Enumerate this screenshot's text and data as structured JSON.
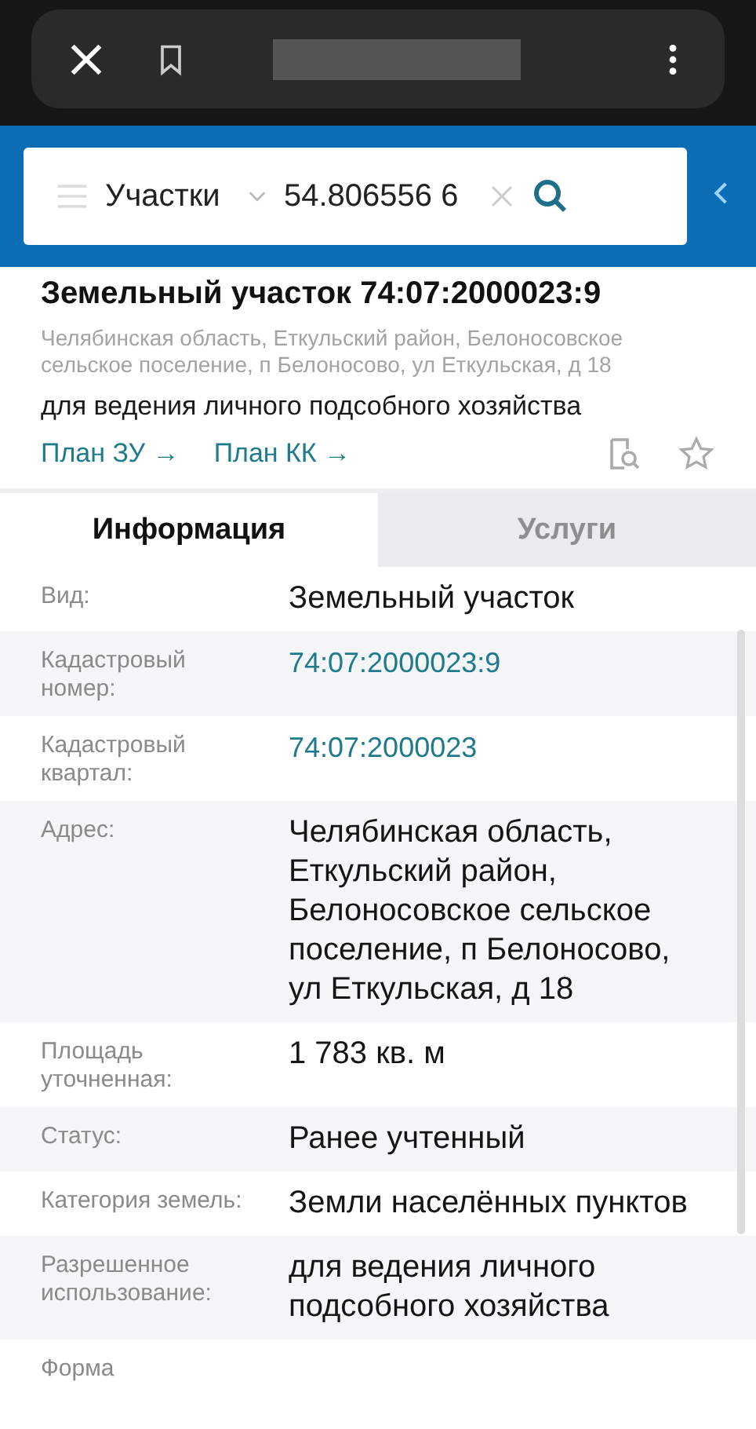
{
  "search": {
    "category": "Участки",
    "value": "54.806556 6"
  },
  "header": {
    "title": "Земельный участок 74:07:2000023:9",
    "address": "Челябинская область, Еткульский район, Белоносовское сельское поселение, п Белоносово, ул Еткульская, д 18",
    "purpose": "для ведения личного подсобного хозяйства",
    "links": [
      "План ЗУ →",
      "План КК →"
    ]
  },
  "tabs": [
    {
      "label": "Информация",
      "selected": true
    },
    {
      "label": "Услуги",
      "selected": false
    }
  ],
  "rows": [
    {
      "label": "Вид:",
      "value": "Земельный участок",
      "kind": "text"
    },
    {
      "label": "Кадастровый номер:",
      "value": "74:07:2000023:9",
      "kind": "link"
    },
    {
      "label": "Кадастровый квартал:",
      "value": "74:07:2000023",
      "kind": "link"
    },
    {
      "label": "Адрес:",
      "value": "Челябинская область, Еткульский район, Белоносовское сельское поселение, п Белоносово, ул Еткульская, д 18",
      "kind": "text"
    },
    {
      "label": "Площадь уточненная:",
      "value": "1 783 кв. м",
      "kind": "text"
    },
    {
      "label": "Статус:",
      "value": "Ранее учтенный",
      "kind": "text"
    },
    {
      "label": "Категория земель:",
      "value": "Земли населённых пунктов",
      "kind": "text"
    },
    {
      "label": "Разрешенное использование:",
      "value": "для ведения личного подсобного хозяйства",
      "kind": "text"
    },
    {
      "label": "Форма"
    }
  ]
}
